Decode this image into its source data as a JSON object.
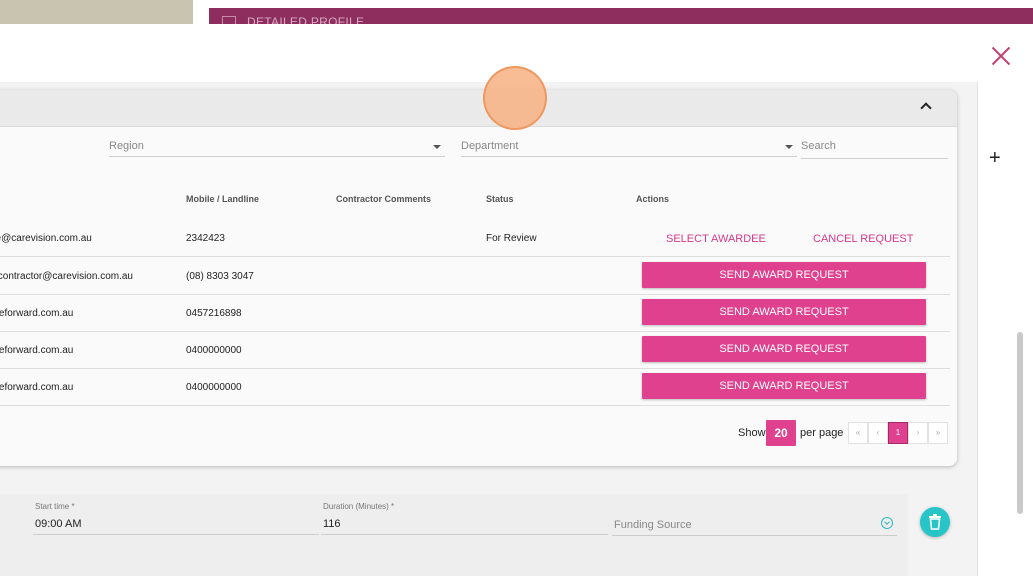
{
  "background": {
    "header_text": "DETAILED PROFILE"
  },
  "filters": {
    "region_label": "Region",
    "department_label": "Department",
    "search_placeholder": "Search"
  },
  "table": {
    "columns": [
      "Mobile / Landline",
      "Contractor Comments",
      "Status",
      "Actions"
    ],
    "rows": [
      {
        "email": "ge@carevision.com.au",
        "phone": "2342423",
        "comments": "",
        "status": "For Review",
        "actions": [
          "SELECT AWARDEE",
          "CANCEL REQUEST"
        ]
      },
      {
        "email": "elcontractor@carevision.com.au",
        "phone": "(08) 8303 3047",
        "comments": "",
        "status": "",
        "actions": [
          "SEND AWARD REQUEST"
        ]
      },
      {
        "email": "areforward.com.au",
        "phone": "0457216898",
        "comments": "",
        "status": "",
        "actions": [
          "SEND AWARD REQUEST"
        ]
      },
      {
        "email": "areforward.com.au",
        "phone": "0400000000",
        "comments": "",
        "status": "",
        "actions": [
          "SEND AWARD REQUEST"
        ]
      },
      {
        "email": "areforward.com.au",
        "phone": "0400000000",
        "comments": "",
        "status": "",
        "actions": [
          "SEND AWARD REQUEST"
        ]
      }
    ]
  },
  "pagination": {
    "show_label": "Show",
    "page_size": "20",
    "per_page_label": "per page",
    "first": "«",
    "prev": "‹",
    "current_page": "1",
    "next": "›",
    "last": "»"
  },
  "form": {
    "start_time_label": "Start time *",
    "start_time_value": "09:00 AM",
    "duration_label": "Duration (Minutes) *",
    "duration_value": "116",
    "funding_source_placeholder": "Funding Source"
  },
  "icons": {
    "close": "close-icon",
    "collapse": "chevron-up-icon",
    "add": "plus-icon",
    "delete": "trash-icon",
    "dropdown": "chevron-down-icon"
  },
  "colors": {
    "accent_pink": "#e0418e",
    "link_pink": "#d6398a",
    "header_plum": "#8e2e5f",
    "teal": "#27c4c8"
  }
}
